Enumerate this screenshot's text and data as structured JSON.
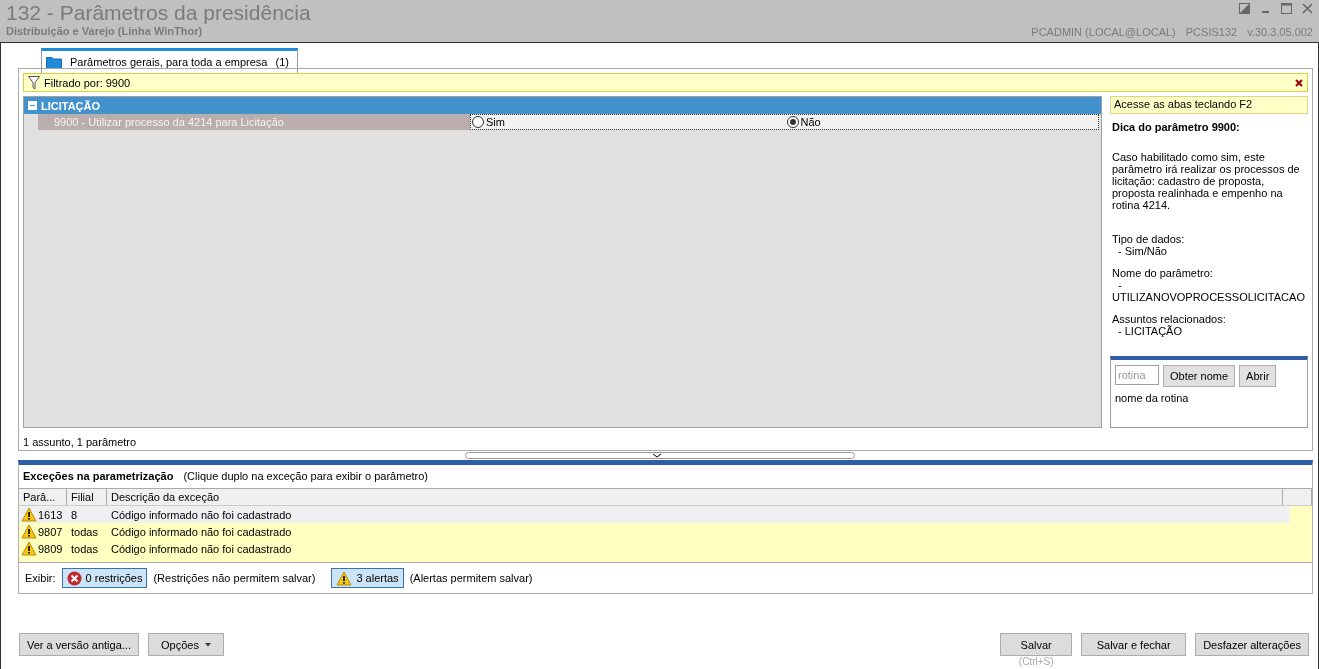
{
  "window": {
    "title": "132 - Parâmetros da presidência",
    "subtitle": "Distribuição e Varejo (Linha WinThor)",
    "user": "PCADMIN (LOCAL@LOCAL)",
    "program": "PCSIS132",
    "version": "v.30.3.05.002"
  },
  "tabs": [
    {
      "label": "Parâmetros gerais, para toda a empresa",
      "count": "(1)",
      "selected": true
    }
  ],
  "filter": {
    "text": "Filtrado por: 9900"
  },
  "group": {
    "title": "LICITAÇÃO",
    "expanded": true,
    "params": [
      {
        "label": "9900 - Utilizar processo da 4214 para Licitação",
        "selected": true,
        "options": [
          {
            "label": "Sim",
            "selected": false
          },
          {
            "label": "Não",
            "selected": true
          }
        ]
      }
    ]
  },
  "grid_status": "1 assunto, 1 parâmetro",
  "hint": {
    "banner": "Acesse as abas teclando F2",
    "title": "Dica do parâmetro 9900:",
    "description": "Caso habilitado como sim, este parâmetro irá realizar os processos de licitação: cadastro de proposta, proposta realinhada e empenho na rotina 4214.",
    "sections": [
      {
        "label": "Tipo de dados:",
        "value": "- Sim/Não"
      },
      {
        "label": "Nome do parâmetro:",
        "value": "-"
      },
      {
        "value": "UTILIZANOVOPROCESSOLICITACAO"
      },
      {
        "label": "Assuntos relacionados:",
        "value": "- LICITAÇÃO"
      }
    ]
  },
  "lookup": {
    "placeholder": "rotina",
    "buttons": [
      "Obter nome",
      "Abrir"
    ],
    "result": "nome da rotina"
  },
  "exceptions": {
    "title": "Exceções na parametrização",
    "hint": "(Clique duplo na exceção para exibir o parâmetro)",
    "columns": [
      "Parâ...",
      "Filial",
      "Descrição da exceção"
    ],
    "rows": [
      {
        "param": "1613",
        "filial": "8",
        "description": "Código informado não foi cadastrado",
        "selected": true
      },
      {
        "param": "9807",
        "filial": "todas",
        "description": "Código informado não foi cadastrado",
        "selected": false
      },
      {
        "param": "9809",
        "filial": "todas",
        "description": "Código informado não foi cadastrado",
        "selected": false
      }
    ],
    "show_label": "Exibir:",
    "toggles": [
      {
        "kind": "error",
        "label": "0 restrições",
        "note": "(Restrições não permitem salvar)",
        "on": true
      },
      {
        "kind": "warning",
        "label": "3 alertas",
        "note": "(Alertas permitem salvar)",
        "on": true
      }
    ]
  },
  "footer": {
    "left": [
      {
        "label": "Ver a versão antiga...",
        "menu": false
      },
      {
        "label": "Opções",
        "menu": true
      }
    ],
    "right": [
      {
        "label": "Salvar",
        "shortcut": "(Ctrl+S)"
      },
      {
        "label": "Salvar e fechar"
      },
      {
        "label": "Desfazer alterações"
      }
    ]
  }
}
